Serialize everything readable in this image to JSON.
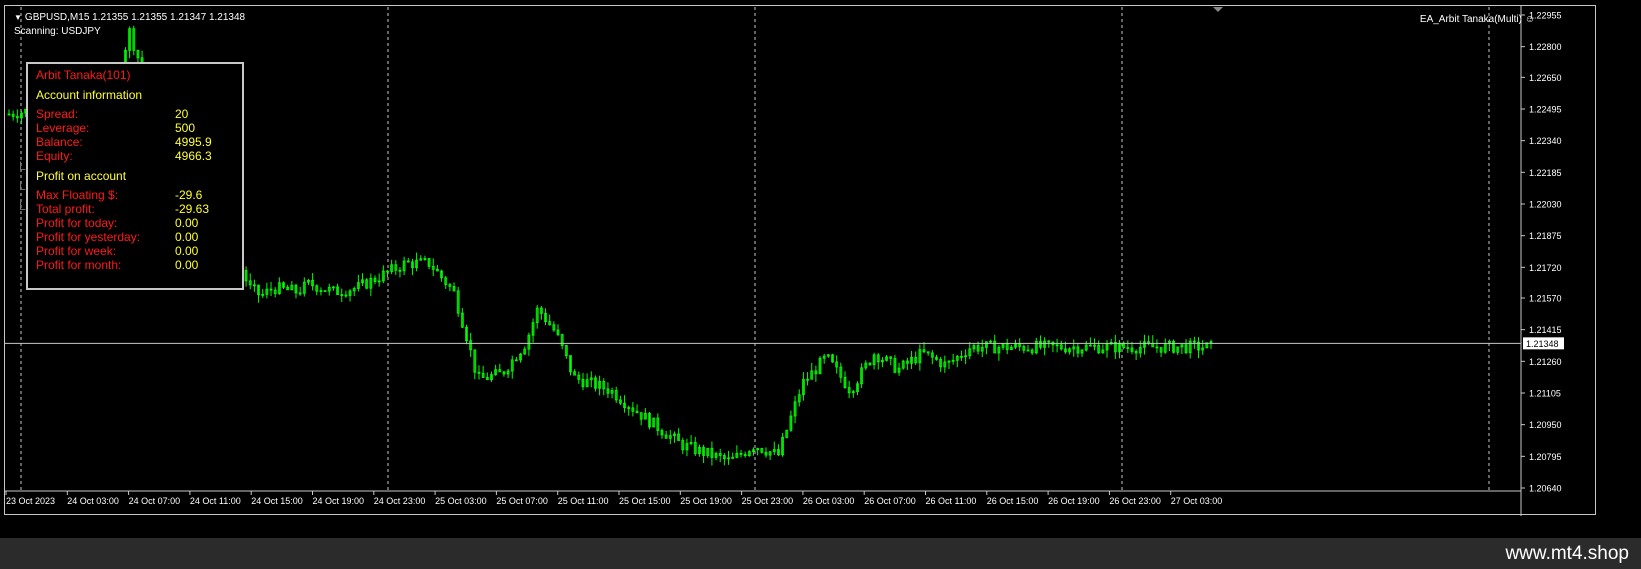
{
  "header": {
    "symbol_info": "GBPUSD,M15  1.21355 1.21355 1.21347 1.21348",
    "scanning": "Scanning: USDJPY",
    "ea_name": "EA_Arbit Tanaka(Multi)"
  },
  "panel": {
    "title": "Arbit Tanaka(101)",
    "account_heading": "Account information",
    "account_rows": [
      {
        "label": "Spread:",
        "value": "20"
      },
      {
        "label": "Leverage:",
        "value": "500"
      },
      {
        "label": "Balance:",
        "value": "4995.9"
      },
      {
        "label": "Equity:",
        "value": "4966.3"
      }
    ],
    "profit_heading": "Profit on account",
    "profit_rows": [
      {
        "label": "Max Floating $:",
        "value": "-29.6"
      },
      {
        "label": "Total profit:",
        "value": "-29.63"
      },
      {
        "label": "Profit for today:",
        "value": "0.00"
      },
      {
        "label": "Profit for yesterday:",
        "value": "0.00"
      },
      {
        "label": "Profit for week:",
        "value": "0.00"
      },
      {
        "label": "Profit for month:",
        "value": "0.00"
      }
    ]
  },
  "chart_data": {
    "type": "candlestick",
    "price_ticks": [
      "1.22955",
      "1.22800",
      "1.22650",
      "1.22495",
      "1.22340",
      "1.22185",
      "1.22030",
      "1.21875",
      "1.21720",
      "1.21570",
      "1.21415",
      "1.21260",
      "1.21105",
      "1.20950",
      "1.20795",
      "1.20640"
    ],
    "ylim": [
      1.2064,
      1.22955
    ],
    "current_price": "1.21348",
    "time_ticks": [
      "23 Oct 2023",
      "24 Oct 03:00",
      "24 Oct 07:00",
      "24 Oct 11:00",
      "24 Oct 15:00",
      "24 Oct 19:00",
      "24 Oct 23:00",
      "25 Oct 03:00",
      "25 Oct 07:00",
      "25 Oct 11:00",
      "25 Oct 15:00",
      "25 Oct 19:00",
      "25 Oct 23:00",
      "26 Oct 03:00",
      "26 Oct 07:00",
      "26 Oct 11:00",
      "26 Oct 15:00",
      "26 Oct 19:00",
      "26 Oct 23:00",
      "27 Oct 03:00"
    ],
    "candle_color": "#00ff00",
    "price_path": [
      [
        0,
        1.2247
      ],
      [
        0.04,
        1.2251
      ],
      [
        0.09,
        1.2262
      ],
      [
        0.1,
        1.2288
      ],
      [
        0.11,
        1.227
      ],
      [
        0.13,
        1.2242
      ],
      [
        0.145,
        1.2228
      ],
      [
        0.155,
        1.2232
      ],
      [
        0.17,
        1.2205
      ],
      [
        0.19,
        1.2176
      ],
      [
        0.2,
        1.2162
      ],
      [
        0.21,
        1.2158
      ],
      [
        0.22,
        1.2162
      ],
      [
        0.24,
        1.216
      ],
      [
        0.25,
        1.2164
      ],
      [
        0.27,
        1.216
      ],
      [
        0.29,
        1.2162
      ],
      [
        0.31,
        1.2168
      ],
      [
        0.33,
        1.2174
      ],
      [
        0.35,
        1.2174
      ],
      [
        0.37,
        1.216
      ],
      [
        0.38,
        1.214
      ],
      [
        0.39,
        1.2117
      ],
      [
        0.41,
        1.212
      ],
      [
        0.43,
        1.2135
      ],
      [
        0.44,
        1.2152
      ],
      [
        0.455,
        1.214
      ],
      [
        0.47,
        1.2118
      ],
      [
        0.5,
        1.2112
      ],
      [
        0.53,
        1.2098
      ],
      [
        0.56,
        1.2085
      ],
      [
        0.6,
        1.2077
      ],
      [
        0.62,
        1.2085
      ],
      [
        0.64,
        1.208
      ],
      [
        0.66,
        1.2115
      ],
      [
        0.68,
        1.2128
      ],
      [
        0.7,
        1.2112
      ],
      [
        0.72,
        1.213
      ],
      [
        0.74,
        1.2122
      ],
      [
        0.76,
        1.213
      ],
      [
        0.78,
        1.2124
      ],
      [
        0.8,
        1.2133
      ]
    ]
  },
  "footer": {
    "watermark": "www.mt4.shop"
  },
  "colors": {
    "panel_label": "#ff1a1a",
    "panel_value": "#ffff33",
    "grid": "#c8c8c8",
    "text": "#ffffff"
  },
  "icons": {
    "collapse": "triangle-down-icon",
    "ea_status": "smiley-icon"
  }
}
